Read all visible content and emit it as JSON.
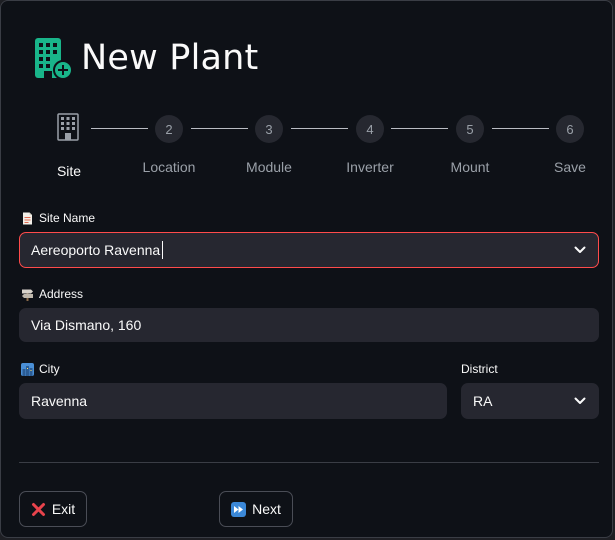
{
  "dialog": {
    "title": "New Plant",
    "title_icon": "building-add-icon",
    "accent_color": "#19b58a"
  },
  "stepper": {
    "active_step": 1,
    "steps": [
      {
        "number": "",
        "label": "Site",
        "icon": "building-icon"
      },
      {
        "number": "2",
        "label": "Location"
      },
      {
        "number": "3",
        "label": "Module"
      },
      {
        "number": "4",
        "label": "Inverter"
      },
      {
        "number": "5",
        "label": "Mount"
      },
      {
        "number": "6",
        "label": "Save"
      }
    ]
  },
  "form": {
    "site_name": {
      "label": "Site Name",
      "icon": "document-icon",
      "value": "Aereoporto Ravenna"
    },
    "address": {
      "label": "Address",
      "icon": "signpost-icon",
      "value": "Via Dismano, 160"
    },
    "city": {
      "label": "City",
      "icon": "cityscape-icon",
      "value": "Ravenna"
    },
    "district": {
      "label": "District",
      "value": "RA"
    }
  },
  "actions": {
    "exit_label": "Exit",
    "next_label": "Next"
  },
  "colors": {
    "focus_border": "#ff4b4b",
    "input_bg": "#262730",
    "background": "#0e1117"
  }
}
